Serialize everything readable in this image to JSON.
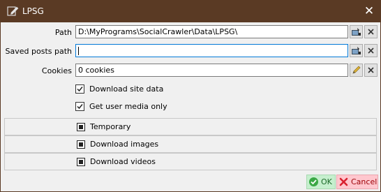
{
  "window": {
    "title": "LPSG",
    "close_symbol": "✕"
  },
  "fields": {
    "path": {
      "label": "Path",
      "value": "D:\\MyPrograms\\SocialCrawler\\Data\\LPSG\\"
    },
    "saved_posts_path": {
      "label": "Saved posts path",
      "value": ""
    },
    "cookies": {
      "label": "Cookies",
      "value": "0 cookies"
    }
  },
  "checkboxes": {
    "download_site_data": {
      "label": "Download site data",
      "checked": true
    },
    "get_user_media_only": {
      "label": "Get user media only",
      "checked": true
    }
  },
  "panels": [
    {
      "label": "Temporary"
    },
    {
      "label": "Download images"
    },
    {
      "label": "Download videos"
    }
  ],
  "buttons": {
    "ok": "OK",
    "cancel": "Cancel"
  },
  "colors": {
    "titlebar": "#5a3a24",
    "ok_background": "#c6efce",
    "cancel_background": "#ffc7ce",
    "ok_text": "#1e6b2a",
    "cancel_text": "#9c0006",
    "focus_border": "#0078d7"
  },
  "icons": {
    "window": "edit-pencil-icon",
    "browse": "browse-folder-icon",
    "edit": "pencil-icon",
    "clear": "clear-x-icon",
    "ok": "checkmark-circle-icon",
    "cancel": "cancel-x-icon"
  }
}
